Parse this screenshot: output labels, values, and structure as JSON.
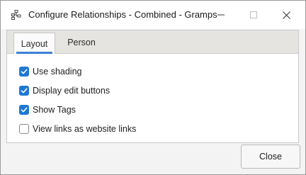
{
  "window": {
    "title": "Configure Relationships - Combined - Gramps",
    "app_icon": "gramps-tree-icon",
    "controls": [
      "minimize-icon",
      "maximize-icon",
      "close-icon"
    ]
  },
  "tabs": [
    {
      "label": "Layout",
      "selected": true
    },
    {
      "label": "Person",
      "selected": false
    }
  ],
  "options": [
    {
      "label": "Use shading",
      "checked": true
    },
    {
      "label": "Display edit buttons",
      "checked": true
    },
    {
      "label": "Show Tags",
      "checked": true
    },
    {
      "label": "View links as website links",
      "checked": false
    }
  ],
  "footer": {
    "close_label": "Close"
  },
  "colors": {
    "accent": "#1f78d1",
    "tab_underline": "#3b82d6",
    "tabbar_bg": "#e6e4e1"
  }
}
